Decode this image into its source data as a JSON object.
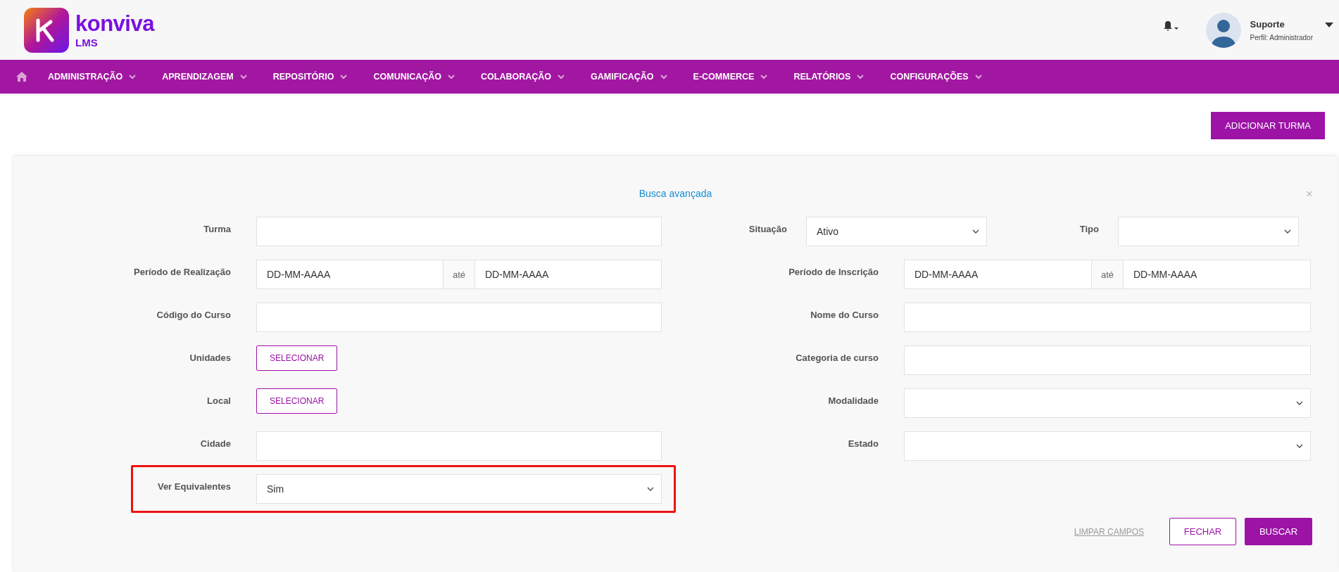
{
  "header": {
    "logo": {
      "name": "konviva",
      "subtitle": "LMS"
    },
    "user": {
      "name": "Suporte",
      "role": "Perfil: Administrador"
    }
  },
  "nav": {
    "items": [
      {
        "label": "ADMINISTRAÇÃO"
      },
      {
        "label": "APRENDIZAGEM"
      },
      {
        "label": "REPOSITÓRIO"
      },
      {
        "label": "COMUNICAÇÃO"
      },
      {
        "label": "COLABORAÇÃO"
      },
      {
        "label": "GAMIFICAÇÃO"
      },
      {
        "label": "E-COMMERCE"
      },
      {
        "label": "RELATÓRIOS"
      },
      {
        "label": "CONFIGURAÇÕES"
      }
    ]
  },
  "actions": {
    "add_button": "ADICIONAR TURMA"
  },
  "search_panel": {
    "title": "Busca avançada",
    "close": "×",
    "rows": [
      {
        "highlighted": false,
        "left": {
          "kind": "text",
          "label": "Turma"
        },
        "right": [
          {
            "kind": "select",
            "label": "Situação",
            "value": "Ativo"
          },
          {
            "kind": "select",
            "label": "Tipo"
          }
        ]
      },
      {
        "highlighted": false,
        "left": {
          "kind": "date_range",
          "label": "Período de Realização",
          "from_placeholder": "DD-MM-AAAA",
          "separator": "até",
          "to_placeholder": "DD-MM-AAAA"
        },
        "right": [
          {
            "kind": "date_range",
            "label": "Período de Inscrição",
            "from_placeholder": "DD-MM-AAAA",
            "separator": "até",
            "to_placeholder": "DD-MM-AAAA"
          }
        ]
      },
      {
        "highlighted": false,
        "left": {
          "kind": "text",
          "label": "Código do Curso"
        },
        "right": [
          {
            "kind": "text",
            "label": "Nome do Curso"
          }
        ]
      },
      {
        "highlighted": false,
        "left": {
          "kind": "picker",
          "label": "Unidades",
          "button": "SELECIONAR"
        },
        "right": [
          {
            "kind": "text",
            "label": "Categoria de curso"
          }
        ]
      },
      {
        "highlighted": false,
        "left": {
          "kind": "picker",
          "label": "Local",
          "button": "SELECIONAR"
        },
        "right": [
          {
            "kind": "select",
            "label": "Modalidade"
          }
        ]
      },
      {
        "highlighted": false,
        "left": {
          "kind": "text",
          "label": "Cidade"
        },
        "right": [
          {
            "kind": "select",
            "label": "Estado"
          }
        ]
      },
      {
        "highlighted": true,
        "left": {
          "kind": "select",
          "label": "Ver Equivalentes",
          "value": "Sim"
        },
        "right": []
      }
    ],
    "footer": {
      "clear_link": "LIMPAR CAMPOS",
      "close_button": "FECHAR",
      "search_button": "BUSCAR"
    }
  }
}
